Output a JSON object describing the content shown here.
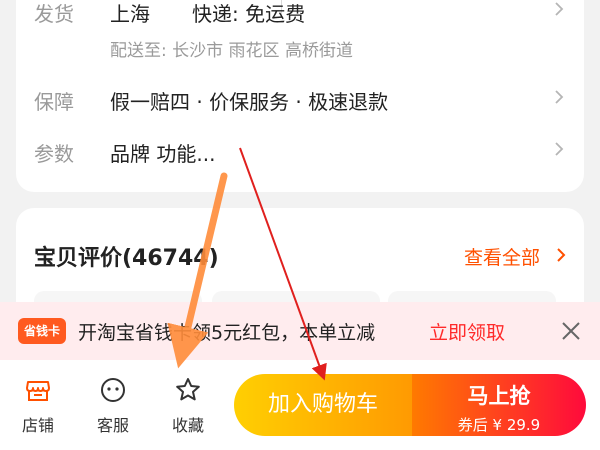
{
  "details": {
    "ship": {
      "label": "发货",
      "origin": "上海",
      "delivery": "快递: 免运费",
      "dest": "配送至: 长沙市 雨花区 高桥街道"
    },
    "guarantee": {
      "label": "保障",
      "value": "假一赔四 · 价保服务 · 极速退款"
    },
    "params": {
      "label": "参数",
      "value": "品牌 功能..."
    }
  },
  "reviews": {
    "title": "宝贝评价(46744)",
    "view_all": "查看全部"
  },
  "promo": {
    "badge": "省钱卡",
    "text": "开淘宝省钱卡领5元红包，本单立减",
    "link": "立即领取"
  },
  "bottom": {
    "tabs": [
      {
        "label": "店铺",
        "icon": "store-icon"
      },
      {
        "label": "客服",
        "icon": "chat-icon"
      },
      {
        "label": "收藏",
        "icon": "star-icon"
      }
    ],
    "add_cart": "加入购物车",
    "buy_now": "马上抢",
    "coupon_price": "券后 ¥ 29.9"
  },
  "colors": {
    "accent": "#ff5000",
    "cart_gradient": [
      "#ffcf02",
      "#ff9a02"
    ],
    "buy_gradient": [
      "#ff7a00",
      "#ff0a3c"
    ],
    "promo_bg": "#ffecee",
    "annotation_orange": "#ff8c3a",
    "annotation_red": "#e0201e"
  }
}
